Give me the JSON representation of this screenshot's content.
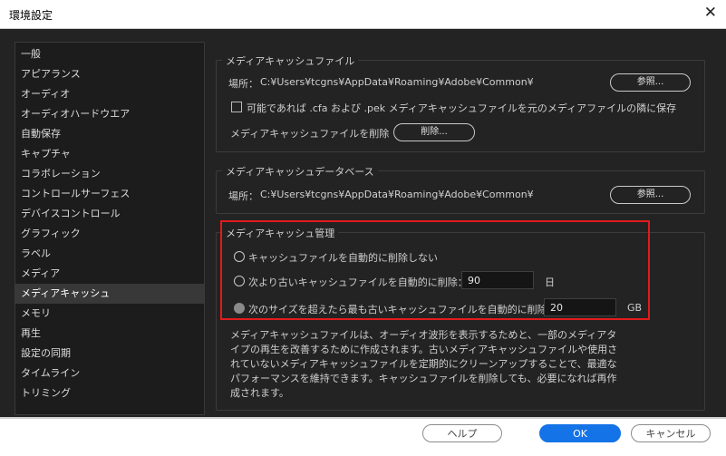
{
  "window": {
    "title": "環境設定",
    "close_glyph": "✕"
  },
  "sidebar": {
    "items": [
      {
        "label": "一般"
      },
      {
        "label": "アピアランス"
      },
      {
        "label": "オーディオ"
      },
      {
        "label": "オーディオハードウエア"
      },
      {
        "label": "自動保存"
      },
      {
        "label": "キャプチャ"
      },
      {
        "label": "コラボレーション"
      },
      {
        "label": "コントロールサーフェス"
      },
      {
        "label": "デバイスコントロール"
      },
      {
        "label": "グラフィック"
      },
      {
        "label": "ラベル"
      },
      {
        "label": "メディア"
      },
      {
        "label": "メディアキャッシュ",
        "selected": true
      },
      {
        "label": "メモリ"
      },
      {
        "label": "再生"
      },
      {
        "label": "設定の同期"
      },
      {
        "label": "タイムライン"
      },
      {
        "label": "トリミング"
      }
    ]
  },
  "media_cache_files": {
    "legend": "メディアキャッシュファイル",
    "location_label": "場所：",
    "location_path": "C:¥Users¥tcgns¥AppData¥Roaming¥Adobe¥Common¥",
    "browse_label": "参照...",
    "save_next_label": "可能であれば .cfa および .pek メディアキャッシュファイルを元のメディアファイルの隣に保存",
    "save_next_checked": false,
    "delete_label": "メディアキャッシュファイルを削除",
    "delete_button": "削除..."
  },
  "media_cache_db": {
    "legend": "メディアキャッシュデータベース",
    "location_label": "場所：",
    "location_path": "C:¥Users¥tcgns¥AppData¥Roaming¥Adobe¥Common¥",
    "browse_label": "参照..."
  },
  "media_cache_management": {
    "legend": "メディアキャッシュ管理",
    "option_never": "キャッシュファイルを自動的に削除しない",
    "option_older": "次より古いキャッシュファイルを自動的に削除：",
    "older_value": "90",
    "older_unit": "日",
    "option_size": "次のサイズを超えたら最も古いキャッシュファイルを自動的に削除：",
    "size_value": "20",
    "size_unit": "GB",
    "description": "メディアキャッシュファイルは、オーディオ波形を表示するためと、一部のメディアタイプの再生を改善するために作成されます。古いメディアキャッシュファイルや使用されていないメディアキャッシュファイルを定期的にクリーンアップすることで、最適なパフォーマンスを維持できます。キャッシュファイルを削除しても、必要になれば再作成されます。"
  },
  "footer": {
    "help": "ヘルプ",
    "ok": "OK",
    "cancel": "キャンセル"
  },
  "colors": {
    "accent": "#1473e6",
    "highlight_box": "#e21b1b"
  }
}
